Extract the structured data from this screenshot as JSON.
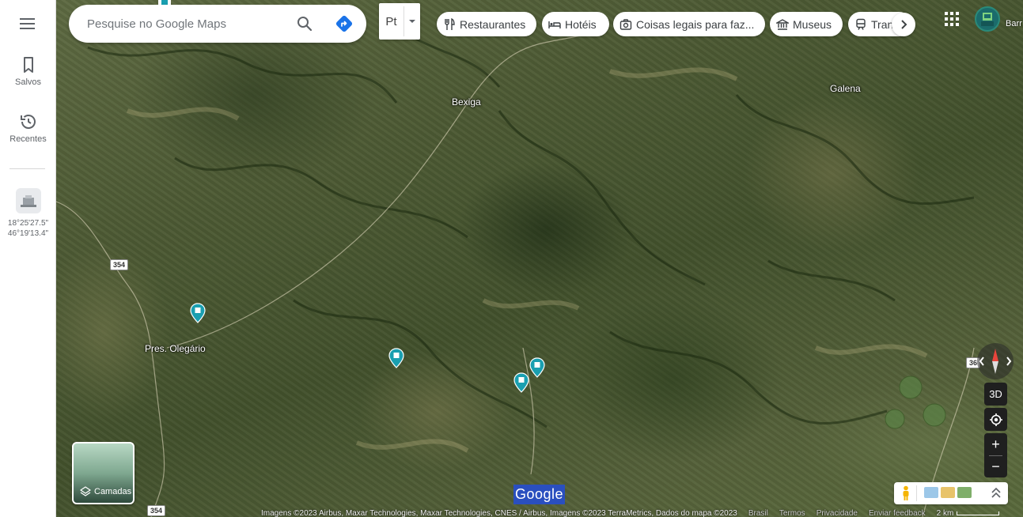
{
  "rail": {
    "saved_label": "Salvos",
    "recent_label": "Recentes",
    "recent_place": {
      "lat": "18°25'27.5\"",
      "lng": "46°19'13.4\""
    }
  },
  "search": {
    "placeholder": "Pesquise no Google Maps"
  },
  "transit_box": {
    "label": "Pt"
  },
  "chips": [
    {
      "label": "Restaurantes",
      "icon": "fork-knife-icon"
    },
    {
      "label": "Hotéis",
      "icon": "bed-icon"
    },
    {
      "label": "Coisas legais para faz...",
      "icon": "camera-icon"
    },
    {
      "label": "Museus",
      "icon": "museum-icon"
    },
    {
      "label": "Tran",
      "icon": "train-icon"
    }
  ],
  "account": {
    "label": "Barr"
  },
  "map": {
    "places": [
      "Bexiga",
      "Galena",
      "Pres. Olegário"
    ],
    "shields": [
      "354",
      "354",
      "36"
    ],
    "pin_color": "#1a9fb0"
  },
  "controls": {
    "three_d": "3D",
    "layers_label": "Camadas"
  },
  "logo": "Google",
  "footer": {
    "attribution": "Imagens ©2023 Airbus, Maxar Technologies, Maxar Technologies, CNES / Airbus, Imagens ©2023 TerraMetrics, Dados do mapa ©2023",
    "country": "Brasil",
    "terms": "Termos",
    "privacy": "Privacidade",
    "feedback": "Enviar feedback",
    "scale": "2 km"
  }
}
